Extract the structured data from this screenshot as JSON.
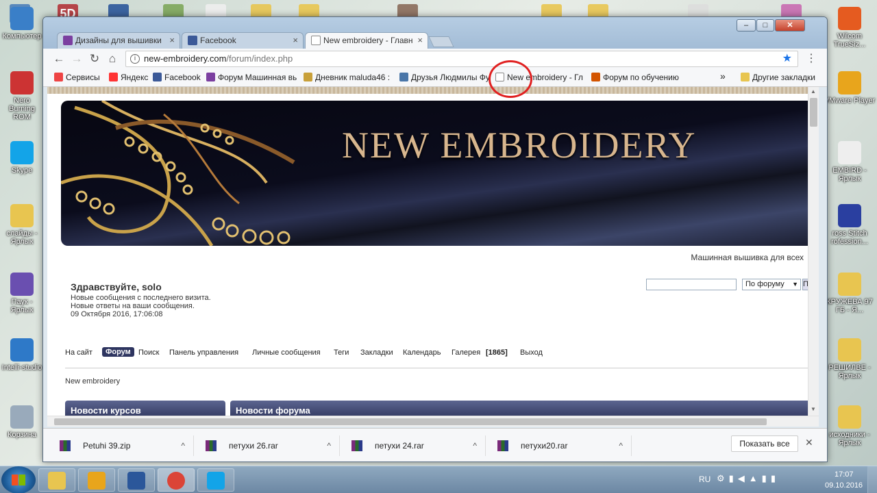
{
  "desktop": {
    "left_icons": [
      {
        "label": "Компьютер",
        "color": "#3a7fc8"
      },
      {
        "label": "Nero Burning ROM",
        "color": "#c33"
      },
      {
        "label": "Skype",
        "color": "#13a4e8"
      },
      {
        "label": "слайды - Ярлык",
        "color": "#e8c550"
      },
      {
        "label": "Паук - Ярлык",
        "color": "#6a4fb0"
      },
      {
        "label": "Intelli-studio",
        "color": "#2e79c8"
      },
      {
        "label": "Корзина",
        "color": "#9ab"
      }
    ],
    "right_icons": [
      {
        "label": "Wilcom TrueSiz...",
        "color": "#e55b20"
      },
      {
        "label": "VMware Player",
        "color": "#e8a51c"
      },
      {
        "label": "EMBIRD - Ярлык",
        "color": "#eee"
      },
      {
        "label": "ross Stitch rofession...",
        "color": "#2a3fa0"
      },
      {
        "label": "КРУЖЕВА 97 ГБ - Я...",
        "color": "#e8c550"
      },
      {
        "label": "РЕШИЛВЕ - Ярлык",
        "color": "#e8c550"
      },
      {
        "label": "исходники - Ярлык",
        "color": "#e8c550"
      }
    ],
    "top_badge": "5D"
  },
  "browser": {
    "tabs": [
      {
        "label": "Дизайны для вышивки",
        "icon": "forum-favicon-icon",
        "color": "#7b3fa0",
        "close": "×"
      },
      {
        "label": "Facebook",
        "icon": "facebook-icon",
        "color": "#3b5998",
        "close": "×"
      },
      {
        "label": "New embroidery - Главн",
        "icon": "page-icon",
        "color": "#ffffff",
        "close": "×"
      }
    ],
    "window_buttons": {
      "minimize": "–",
      "maximize": "□",
      "close": "✕"
    },
    "url_domain": "new-embroidery.com",
    "url_path": "/forum/index.php",
    "bookmarks": [
      {
        "label": "Сервисы",
        "icon": "apps-icon",
        "color": "#e44"
      },
      {
        "label": "Яндекс",
        "icon": "yandex-icon",
        "color": "#f33"
      },
      {
        "label": "Facebook",
        "icon": "facebook-icon",
        "color": "#3b5998"
      },
      {
        "label": "Форум Машинная вь",
        "icon": "forum-favicon-icon",
        "color": "#7b3fa0"
      },
      {
        "label": "Дневник maluda46 :",
        "icon": "li-icon",
        "color": "#c8a03a"
      },
      {
        "label": "Друзья Людмилы Фу",
        "icon": "vk-icon",
        "color": "#4a76a8"
      },
      {
        "label": "New embroidery - Гл",
        "icon": "page-icon",
        "color": "#ffffff"
      },
      {
        "label": "Форум по обучению",
        "icon": "forum-icon",
        "color": "#d35400"
      }
    ],
    "bookmarks_overflow": "»",
    "other_bookmarks": "Другие закладки"
  },
  "page": {
    "banner_title": "NEW EMBROIDERY",
    "tagline": "Машинная вышивка для всех",
    "greeting": "Здравствуйте, solo",
    "new_since": "Новые сообщения с последнего визита.",
    "new_replies": "Новые ответы на ваши сообщения.",
    "datetime": "09 Октября 2016, 17:06:08",
    "search_scope": "По форуму",
    "search_button": "По",
    "nav": [
      "На сайт",
      "Форум",
      "Поиск",
      "Панель управления",
      "Личные сообщения",
      "Теги",
      "Закладки",
      "Календарь",
      "Галерея",
      "[1865]",
      "Выход"
    ],
    "breadcrumb": "New embroidery",
    "panel_left": "Новости курсов",
    "panel_right": "Новости форума"
  },
  "downloads": {
    "items": [
      "Petuhi 39.zip",
      "петухи 26.rar",
      "петухи 24.rar",
      "петухи20.rar"
    ],
    "chevron": "^",
    "show_all": "Показать все",
    "close": "✕"
  },
  "taskbar": {
    "lang": "RU",
    "time": "17:07",
    "date": "09.10.2016",
    "apps": [
      {
        "icon": "explorer-icon",
        "color": "#e8c550"
      },
      {
        "icon": "archicad-icon",
        "color": "#e8a51c"
      },
      {
        "icon": "word-icon",
        "color": "#2b579a"
      },
      {
        "icon": "chrome-icon",
        "color": "#db4437"
      },
      {
        "icon": "skype-icon",
        "color": "#13a4e8"
      }
    ]
  },
  "colors": {
    "annotation": "#e02020",
    "accent_star": "#1a73e8"
  }
}
